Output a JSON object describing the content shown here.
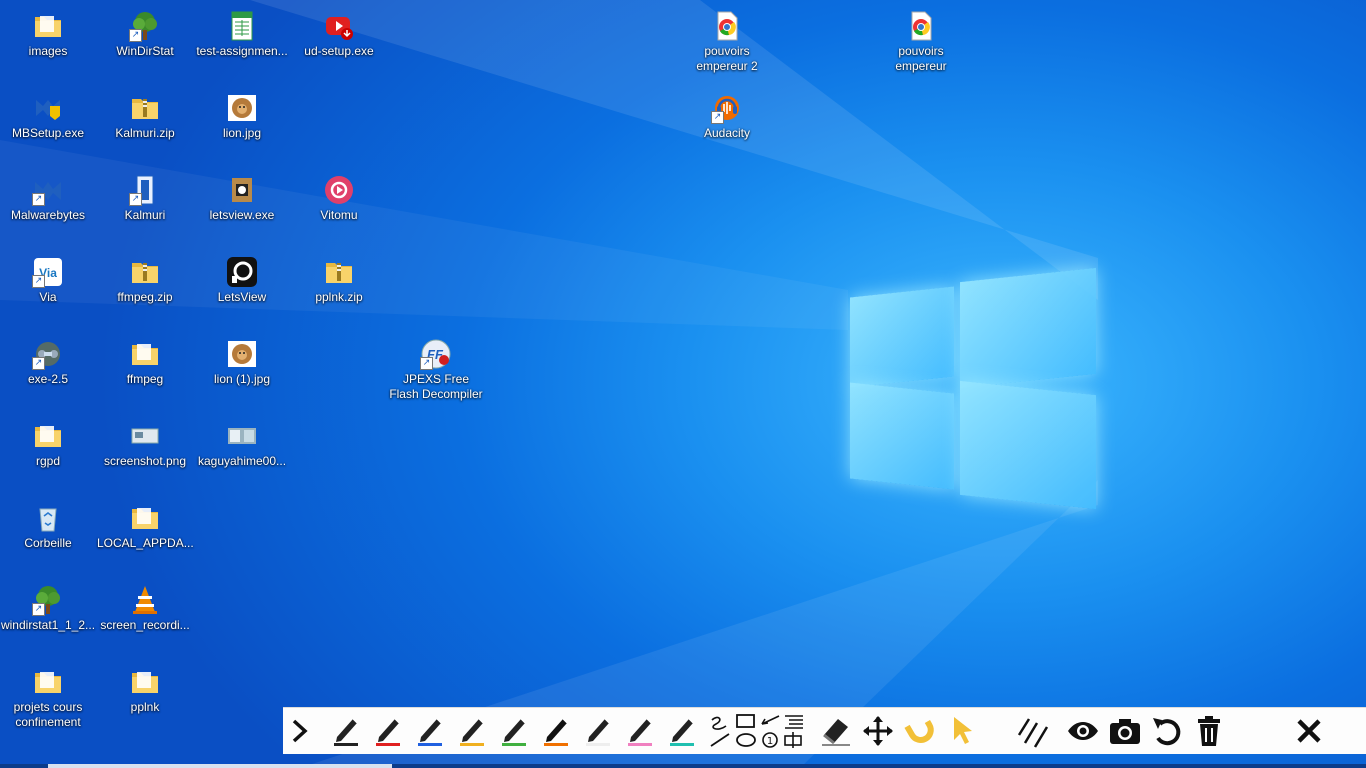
{
  "desktop": {
    "icons": [
      {
        "label": "images",
        "kind": "folder"
      },
      {
        "label": "WinDirStat",
        "kind": "windirstat"
      },
      {
        "label": "test-assignmen...",
        "kind": "spreadsheet"
      },
      {
        "label": "ud-setup.exe",
        "kind": "youtube"
      },
      {
        "label": "MBSetup.exe",
        "kind": "malwarebytes-setup"
      },
      {
        "label": "Kalmuri.zip",
        "kind": "zip"
      },
      {
        "label": "lion.jpg",
        "kind": "image"
      },
      {
        "label": "Malwarebytes",
        "kind": "malwarebytes"
      },
      {
        "label": "Kalmuri",
        "kind": "kalmuri"
      },
      {
        "label": "letsview.exe",
        "kind": "letsview-setup"
      },
      {
        "label": "Vitomu",
        "kind": "vitomu"
      },
      {
        "label": "Via",
        "kind": "via"
      },
      {
        "label": "ffmpeg.zip",
        "kind": "zip"
      },
      {
        "label": "LetsView",
        "kind": "letsview"
      },
      {
        "label": "pplnk.zip",
        "kind": "zip"
      },
      {
        "label": "exe-2.5",
        "kind": "exe"
      },
      {
        "label": "ffmpeg",
        "kind": "folder"
      },
      {
        "label": "lion (1).jpg",
        "kind": "image"
      },
      {
        "label": "JPEXS Free Flash Decompiler",
        "kind": "jpexs"
      },
      {
        "label": "rgpd",
        "kind": "folder"
      },
      {
        "label": "screenshot.png",
        "kind": "png"
      },
      {
        "label": "kaguyahime00...",
        "kind": "photo"
      },
      {
        "label": "Corbeille",
        "kind": "recycle-bin"
      },
      {
        "label": "LOCAL_APPDA...",
        "kind": "folder"
      },
      {
        "label": "windirstat1_1_2...",
        "kind": "windirstat"
      },
      {
        "label": "screen_recordi...",
        "kind": "vlc"
      },
      {
        "label": "projets cours confinement",
        "kind": "folder"
      },
      {
        "label": "pplnk",
        "kind": "folder"
      },
      {
        "label": "pouvoirs empereur 2",
        "kind": "chrome-doc"
      },
      {
        "label": "Audacity",
        "kind": "audacity"
      },
      {
        "label": "pouvoirs empereur",
        "kind": "chrome-doc"
      }
    ]
  },
  "toolbar": {
    "pen_colors": [
      "#222222",
      "#e02020",
      "#2060e0",
      "#f0b020",
      "#40b040",
      "#f07000",
      "#eeeeee",
      "#f080c0",
      "#20c0b0"
    ],
    "tools": [
      "collapse",
      "pen",
      "freehand",
      "rectangle",
      "arrow",
      "text",
      "line",
      "ellipse",
      "numbered",
      "select-box",
      "eraser",
      "move",
      "magnet",
      "pointer",
      "multi-line",
      "eye",
      "camera",
      "undo",
      "trash",
      "close"
    ]
  },
  "colors": {
    "accent": "#0b6fe0",
    "toolbar_bg": "#fdfdfd"
  }
}
